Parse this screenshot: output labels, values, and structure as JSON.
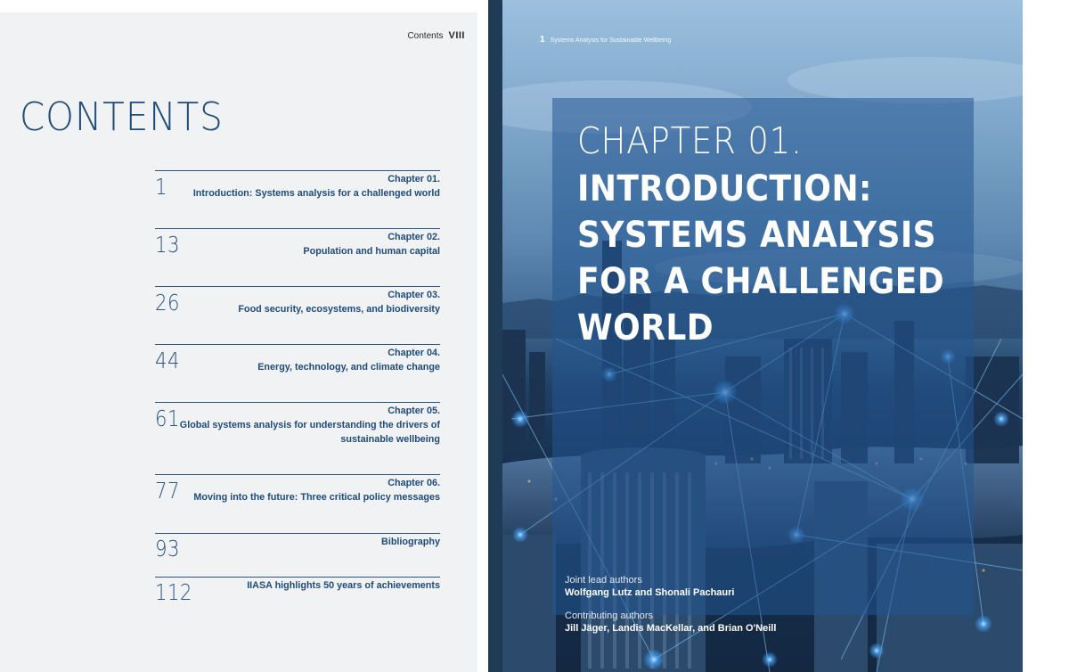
{
  "left_page": {
    "running_head": {
      "label": "Contents",
      "page": "VIII"
    },
    "title": "CONTENTS",
    "entries": [
      {
        "page": "1",
        "lines": [
          "Chapter 01.",
          "Introduction: Systems analysis for a challenged world"
        ]
      },
      {
        "page": "13",
        "lines": [
          "Chapter 02.",
          "Population and human capital"
        ]
      },
      {
        "page": "26",
        "lines": [
          "Chapter 03.",
          "Food security, ecosystems, and biodiversity"
        ]
      },
      {
        "page": "44",
        "lines": [
          "Chapter 04.",
          "Energy, technology, and climate change"
        ]
      },
      {
        "page": "61",
        "lines": [
          "Chapter 05.",
          "Global systems analysis for understanding the drivers of",
          "sustainable wellbeing"
        ]
      },
      {
        "page": "77",
        "lines": [
          "Chapter 06.",
          "Moving into the future: Three critical policy messages"
        ]
      },
      {
        "page": "93",
        "lines": [
          "Bibliography"
        ]
      },
      {
        "page": "112",
        "lines": [
          "IIASA highlights 50 years of achievements"
        ]
      }
    ]
  },
  "right_page": {
    "running_head": {
      "page": "1",
      "title": "Systems Analysis for Sustainable Wellbeing"
    },
    "chapter_label": "CHAPTER 01.",
    "chapter_title_lines": [
      "INTRODUCTION:",
      "SYSTEMS ANALYSIS",
      "FOR A CHALLENGED",
      "WORLD"
    ],
    "joint_lead_label": "Joint lead authors",
    "joint_lead_names": "Wolfgang Lutz and Shonali Pachauri",
    "contributing_label": "Contributing authors",
    "contributing_names": "Jill Jäger, Landis MacKellar, and Brian O'Neill"
  },
  "colors": {
    "accent_blue": "#1f4b7a",
    "left_page_bg": "#f0f2f3",
    "title_panel": "#235591",
    "network_glow": "#4aa8ff"
  }
}
